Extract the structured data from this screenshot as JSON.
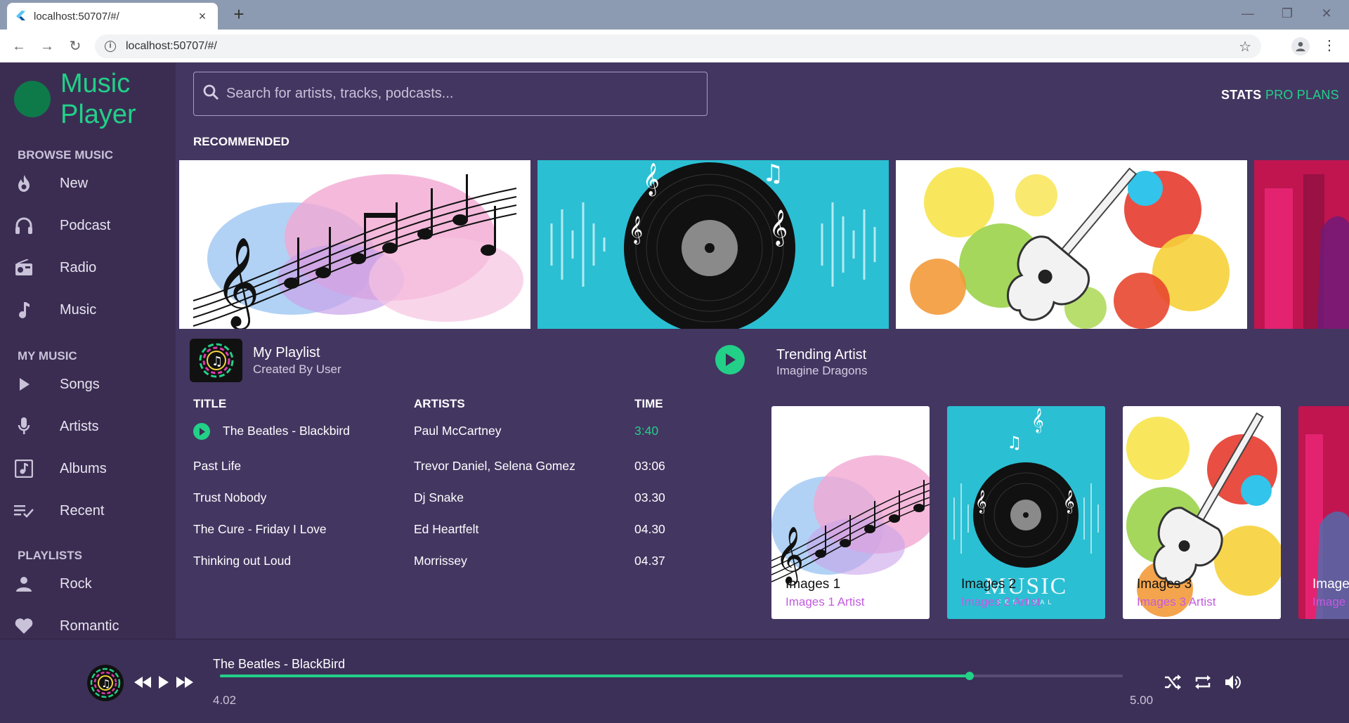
{
  "browser": {
    "tab_title": "localhost:50707/#/",
    "url": "localhost:50707/#/",
    "new_tab": "+",
    "close_tab": "×"
  },
  "app": {
    "brand": [
      "Music",
      "Player"
    ],
    "search_placeholder": "Search for artists, tracks, podcasts...",
    "top_links": [
      "STATS",
      "PRO PLANS"
    ],
    "accent": "#22d088",
    "bg": "#433661",
    "sidebar_bg": "#3b2d52"
  },
  "sidebar": {
    "sections": [
      {
        "title": "BROWSE MUSIC",
        "items": [
          {
            "label": "New",
            "icon": "fire-icon"
          },
          {
            "label": "Podcast",
            "icon": "headphones-icon"
          },
          {
            "label": "Radio",
            "icon": "radio-icon"
          },
          {
            "label": "Music",
            "icon": "music-note-icon"
          }
        ]
      },
      {
        "title": "MY MUSIC",
        "items": [
          {
            "label": "Songs",
            "icon": "play-icon"
          },
          {
            "label": "Artists",
            "icon": "microphone-icon"
          },
          {
            "label": "Albums",
            "icon": "album-icon"
          },
          {
            "label": "Recent",
            "icon": "playlist-check-icon"
          }
        ]
      },
      {
        "title": "PLAYLISTS",
        "items": [
          {
            "label": "Rock",
            "icon": "person-icon"
          },
          {
            "label": "Romantic",
            "icon": "heart-icon"
          }
        ]
      }
    ]
  },
  "recommended": {
    "label": "RECOMMENDED",
    "banners": [
      "music-notes-watercolor",
      "vinyl-record-teal",
      "guitar-paint-splash",
      "concert-pink"
    ]
  },
  "playlist": {
    "title": "My Playlist",
    "subtitle": "Created By User",
    "headers": [
      "TITLE",
      "ARTISTS",
      "TIME"
    ],
    "rows": [
      {
        "title": "The Beatles - Blackbird",
        "artists": "Paul McCartney",
        "time": "3:40",
        "playing": true
      },
      {
        "title": "Past Life",
        "artists": "Trevor Daniel, Selena Gomez",
        "time": "03:06"
      },
      {
        "title": "Trust Nobody",
        "artists": "Dj Snake",
        "time": "03.30"
      },
      {
        "title": "The Cure - Friday I Love",
        "artists": "Ed Heartfelt",
        "time": "04.30"
      },
      {
        "title": "Thinking out Loud",
        "artists": "Morrissey",
        "time": "04.37"
      }
    ]
  },
  "trending": {
    "title": "Trending Artist",
    "subtitle": "Imagine Dragons",
    "cards": [
      {
        "name": "Images 1",
        "artist": "Images 1 Artist"
      },
      {
        "name": "Images 2",
        "artist": "Images 2 Artist",
        "badge": "MUSIC",
        "badge_sub": "FESTIVAL"
      },
      {
        "name": "Images 3",
        "artist": "Images 3 Artist"
      },
      {
        "name": "Image",
        "artist": "Image"
      }
    ]
  },
  "player": {
    "now_playing": "The Beatles - BlackBird",
    "current": "4.02",
    "total": "5.00",
    "progress": 0.83
  }
}
